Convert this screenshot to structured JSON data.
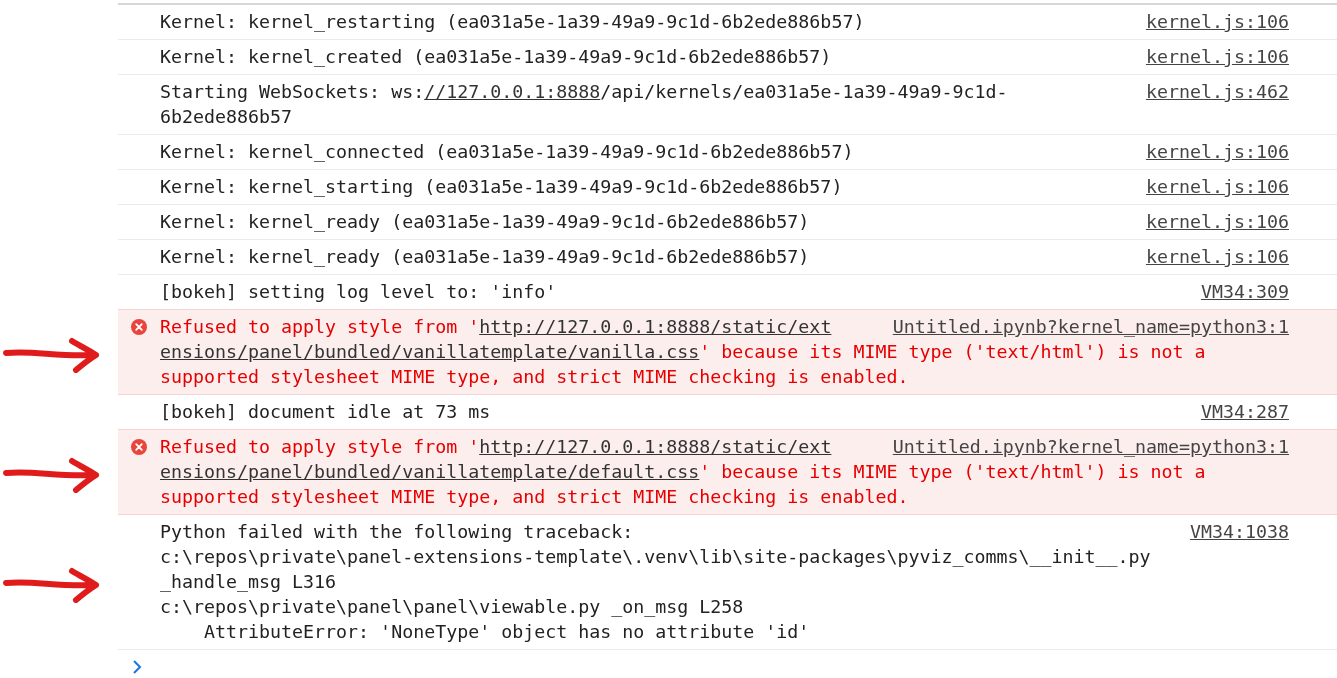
{
  "console": {
    "messages": [
      {
        "kind": "log",
        "marked": false,
        "source": "kernel.js:106",
        "lines": [
          [
            {
              "text": "Kernel: kernel_restarting (ea031a5e-1a39-49a9-9c1d-6b2ede886b57)",
              "kind": "text"
            }
          ]
        ]
      },
      {
        "kind": "log",
        "marked": false,
        "source": "kernel.js:106",
        "lines": [
          [
            {
              "text": "Kernel: kernel_created (ea031a5e-1a39-49a9-9c1d-6b2ede886b57)",
              "kind": "text"
            }
          ]
        ]
      },
      {
        "kind": "log",
        "marked": false,
        "source": "kernel.js:462",
        "lines": [
          [
            {
              "text": "Starting WebSockets: ws:",
              "kind": "text"
            },
            {
              "text": "//127.0.0.1:8888",
              "kind": "url"
            },
            {
              "text": "/api/kernels/ea031a5e-1a39-49a9-9c1d-",
              "kind": "text"
            }
          ],
          [
            {
              "text": "6b2ede886b57",
              "kind": "text"
            }
          ]
        ]
      },
      {
        "kind": "log",
        "marked": false,
        "source": "kernel.js:106",
        "lines": [
          [
            {
              "text": "Kernel: kernel_connected (ea031a5e-1a39-49a9-9c1d-6b2ede886b57)",
              "kind": "text"
            }
          ]
        ]
      },
      {
        "kind": "log",
        "marked": false,
        "source": "kernel.js:106",
        "lines": [
          [
            {
              "text": "Kernel: kernel_starting (ea031a5e-1a39-49a9-9c1d-6b2ede886b57)",
              "kind": "text"
            }
          ]
        ]
      },
      {
        "kind": "log",
        "marked": false,
        "source": "kernel.js:106",
        "lines": [
          [
            {
              "text": "Kernel: kernel_ready (ea031a5e-1a39-49a9-9c1d-6b2ede886b57)",
              "kind": "text"
            }
          ]
        ]
      },
      {
        "kind": "log",
        "marked": false,
        "source": "kernel.js:106",
        "lines": [
          [
            {
              "text": "Kernel: kernel_ready (ea031a5e-1a39-49a9-9c1d-6b2ede886b57)",
              "kind": "text"
            }
          ]
        ]
      },
      {
        "kind": "log",
        "marked": false,
        "source": "VM34:309",
        "lines": [
          [
            {
              "text": "[bokeh] setting log level to: 'info'",
              "kind": "text"
            }
          ]
        ]
      },
      {
        "kind": "error",
        "marked": true,
        "source": "Untitled.ipynb?kernel_name=python3:1",
        "lines": [
          [
            {
              "text": "Refused to apply style from '",
              "kind": "text"
            },
            {
              "text": "http://127.0.0.1:8888/static/ext",
              "kind": "url"
            }
          ],
          [
            {
              "text": "ensions/panel/bundled/vanillatemplate/vanilla.css",
              "kind": "url"
            },
            {
              "text": "' because its MIME type ('text/html') is not a",
              "kind": "text"
            }
          ],
          [
            {
              "text": "supported stylesheet MIME type, and strict MIME checking is enabled.",
              "kind": "text"
            }
          ]
        ]
      },
      {
        "kind": "log",
        "marked": false,
        "source": "VM34:287",
        "lines": [
          [
            {
              "text": "[bokeh] document idle at 73 ms",
              "kind": "text"
            }
          ]
        ]
      },
      {
        "kind": "error",
        "marked": true,
        "source": "Untitled.ipynb?kernel_name=python3:1",
        "lines": [
          [
            {
              "text": "Refused to apply style from '",
              "kind": "text"
            },
            {
              "text": "http://127.0.0.1:8888/static/ext",
              "kind": "url"
            }
          ],
          [
            {
              "text": "ensions/panel/bundled/vanillatemplate/default.css",
              "kind": "url"
            },
            {
              "text": "' because its MIME type ('text/html') is not a",
              "kind": "text"
            }
          ],
          [
            {
              "text": "supported stylesheet MIME type, and strict MIME checking is enabled.",
              "kind": "text"
            }
          ]
        ]
      },
      {
        "kind": "log",
        "marked": true,
        "source": "VM34:1038",
        "lines": [
          [
            {
              "text": "Python failed with the following traceback:",
              "kind": "text"
            }
          ],
          [
            {
              "text": "c:\\repos\\private\\panel-extensions-template\\.venv\\lib\\site-packages\\pyviz_comms\\__init__.py",
              "kind": "text"
            }
          ],
          [
            {
              "text": "_handle_msg L316",
              "kind": "text"
            }
          ],
          [
            {
              "text": "c:\\repos\\private\\panel\\panel\\viewable.py _on_msg L258",
              "kind": "text"
            }
          ],
          [
            {
              "text": "    AttributeError: 'NoneType' object has no attribute 'id'",
              "kind": "text"
            }
          ]
        ]
      }
    ]
  }
}
